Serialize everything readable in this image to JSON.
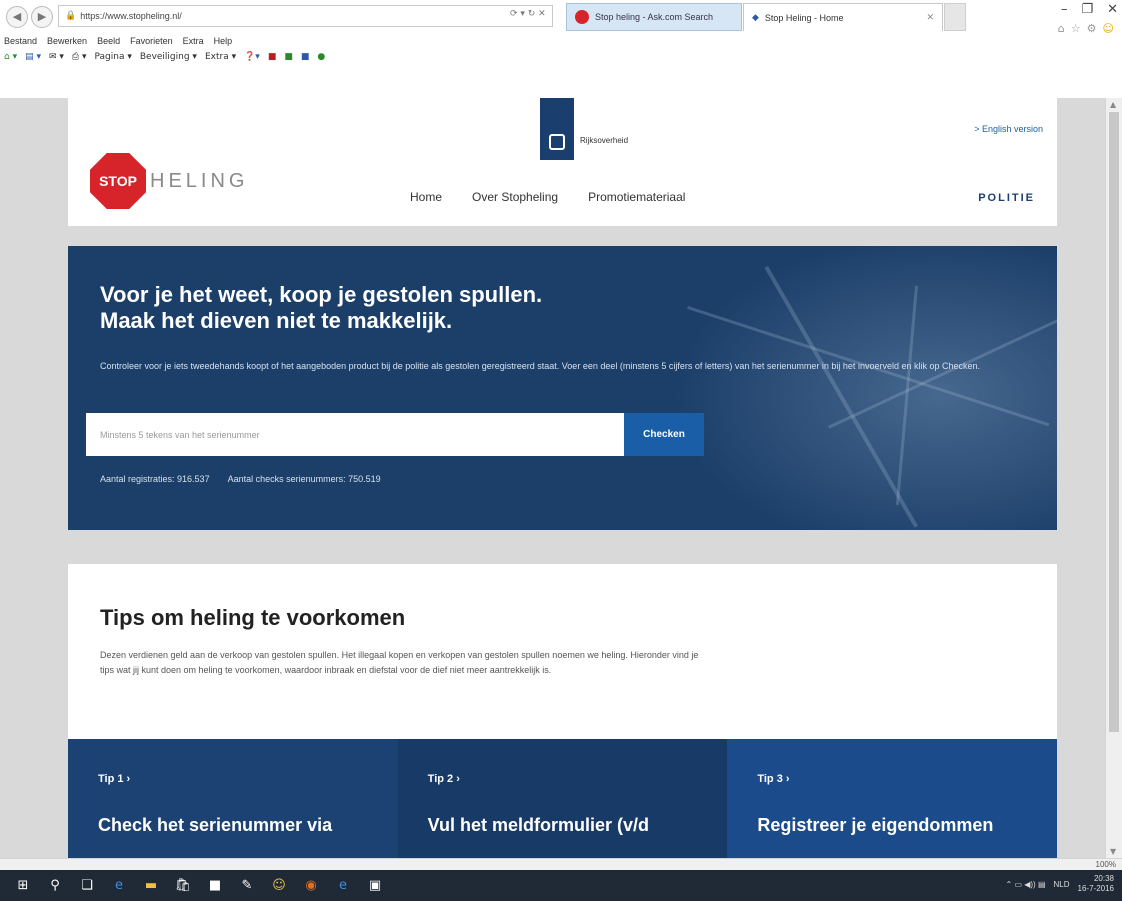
{
  "browser": {
    "address": "https://www.stopheling.nl/",
    "tabs": [
      {
        "label": "Stop heling - Ask.com Search"
      },
      {
        "label": "Stop Heling - Home"
      }
    ],
    "menu": [
      "Bestand",
      "Bewerken",
      "Beeld",
      "Favorieten",
      "Extra",
      "Help"
    ],
    "commands": [
      "Pagina ▾",
      "Beveiliging ▾",
      "Extra ▾"
    ],
    "zoom": "100%"
  },
  "site": {
    "logo_sign": "STOP",
    "logo_text": "HELING",
    "gov_text": "Rijksoverheid",
    "lang_link": "> English version",
    "nav": [
      "Home",
      "Over Stopheling",
      "Promotiemateriaal"
    ],
    "politie": "POLITIE"
  },
  "hero": {
    "title_line1": "Voor je het weet, koop je gestolen spullen.",
    "title_line2": "Maak het dieven niet te makkelijk.",
    "subtitle": "Controleer voor je iets tweedehands koopt of het aangeboden product bij de politie als gestolen geregistreerd staat. Voer een deel (minstens 5 cijfers of letters) van het serienummer in bij het invoerveld en klik op Checken.",
    "search_placeholder": "Minstens 5 tekens van het serienummer",
    "check_button": "Checken",
    "stat_registrations": "Aantal registraties: 916.537",
    "stat_checks": "Aantal checks serienummers: 750.519"
  },
  "tips": {
    "heading": "Tips om heling te voorkomen",
    "intro": "Dezen verdienen geld aan de verkoop van gestolen spullen. Het illegaal kopen en verkopen van gestolen spullen noemen we heling. Hieronder vind je tips wat jij kunt doen om heling te voorkomen, waardoor inbraak en diefstal voor de dief niet meer aantrekkelijk is.",
    "items": [
      {
        "label": "Tip 1 ›",
        "title": "Check het serienummer via"
      },
      {
        "label": "Tip 2 ›",
        "title": "Vul het meldformulier (v/d"
      },
      {
        "label": "Tip 3 ›",
        "title": "Registreer je eigendommen"
      }
    ]
  },
  "taskbar": {
    "time": "20:38",
    "date": "16-7-2016",
    "lang": "NLD"
  }
}
